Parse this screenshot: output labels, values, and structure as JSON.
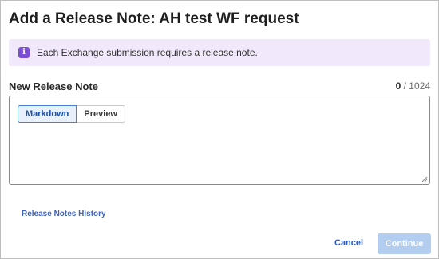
{
  "dialog": {
    "title": "Add a Release Note: AH test WF request"
  },
  "info_banner": {
    "icon": "info-icon",
    "icon_glyph": "i",
    "text": "Each Exchange submission requires a release note.",
    "background": "#f1e9fb",
    "icon_color": "#7b4fd1"
  },
  "release_note": {
    "label": "New Release Note",
    "char_count": "0",
    "separator": " / ",
    "char_limit": "1024",
    "value": "",
    "tabs": [
      {
        "label": "Markdown",
        "active": true
      },
      {
        "label": "Preview",
        "active": false
      }
    ]
  },
  "links": {
    "history": "Release Notes History"
  },
  "footer": {
    "cancel_label": "Cancel",
    "continue_label": "Continue",
    "continue_disabled": true,
    "accent_color": "#2a5bc2"
  }
}
